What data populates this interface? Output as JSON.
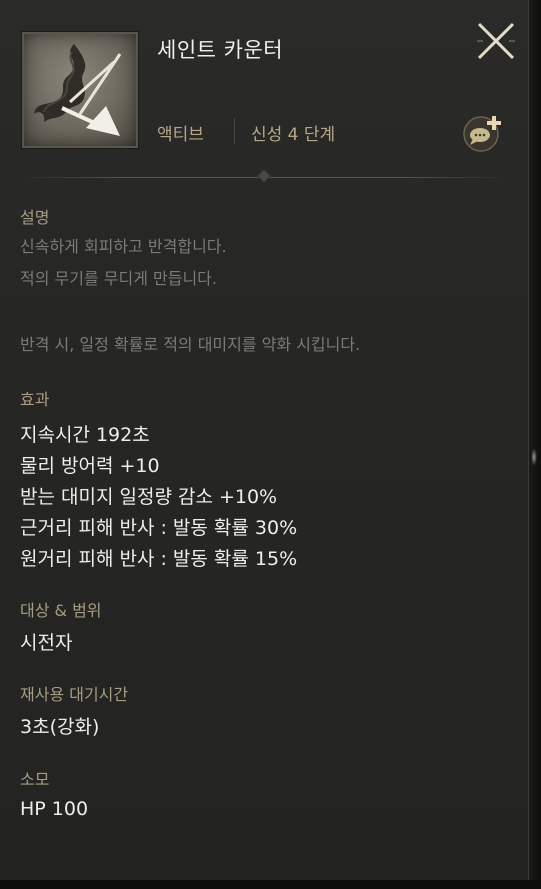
{
  "skill": {
    "name": "세인트 카운터",
    "type": "액티브",
    "tier": "신성 4 단계",
    "icon": "dodge-arrow-icon"
  },
  "description": {
    "label": "설명",
    "lines": [
      "신속하게 회피하고 반격합니다.",
      "적의 무기를 무디게 만듭니다.",
      "",
      "반격 시, 일정 확률로 적의 대미지를 약화 시킵니다."
    ]
  },
  "effects": {
    "label": "효과",
    "items": [
      "지속시간 192초",
      "물리 방어력 +10",
      "받는 대미지 일정량 감소 +10%",
      "근거리 피해 반사 : 발동 확률 30%",
      "원거리 피해 반사 : 발동 확률 15%"
    ]
  },
  "target": {
    "label": "대상 & 범위",
    "value": "시전자"
  },
  "cooldown": {
    "label": "재사용 대기시간",
    "value": "3초(강화)"
  },
  "cost": {
    "label": "소모",
    "value": "HP 100"
  },
  "icons": {
    "close": "close-icon",
    "chat": "chat-link-icon"
  },
  "colors": {
    "background": "#262624",
    "label": "#a89c83",
    "description": "#7d7a73",
    "value": "#efede8",
    "type": "#b5a788"
  }
}
